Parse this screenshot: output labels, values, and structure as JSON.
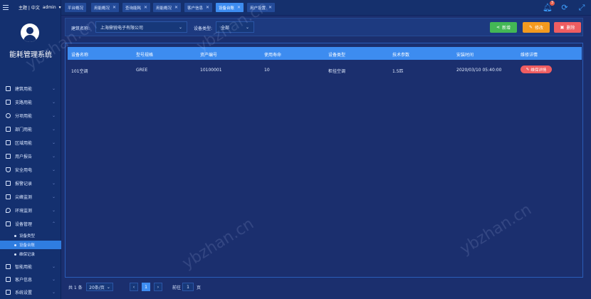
{
  "header": {
    "user_menu": "主题 | 中文",
    "username": "admin",
    "notification_count": "3"
  },
  "tabs": [
    {
      "label": "平台概况",
      "closable": false
    },
    {
      "label": "用能概况",
      "closable": true
    },
    {
      "label": "查询能耗",
      "closable": true
    },
    {
      "label": "用能概况",
      "closable": true
    },
    {
      "label": "客户信息",
      "closable": true
    },
    {
      "label": "设备台账",
      "closable": true,
      "active": true
    },
    {
      "label": "用户设置",
      "closable": true
    }
  ],
  "sidebar": {
    "title": "能耗管理系统",
    "items": [
      {
        "label": "建筑用能",
        "icon": "building-icon"
      },
      {
        "label": "支路用能",
        "icon": "branch-icon"
      },
      {
        "label": "分项用能",
        "icon": "pie-icon"
      },
      {
        "label": "部门用能",
        "icon": "department-icon"
      },
      {
        "label": "区域用能",
        "icon": "region-icon"
      },
      {
        "label": "用户报告",
        "icon": "report-icon"
      },
      {
        "label": "安全用电",
        "icon": "shield-icon"
      },
      {
        "label": "报警记录",
        "icon": "alarm-icon"
      },
      {
        "label": "尖峰监测",
        "icon": "monitor-icon"
      },
      {
        "label": "环境监测",
        "icon": "location-icon"
      },
      {
        "label": "设备管理",
        "icon": "wrench-icon"
      }
    ],
    "sub_items": [
      {
        "label": "设备类型",
        "active": false
      },
      {
        "label": "设备台账",
        "active": true
      },
      {
        "label": "维保记录",
        "active": false
      }
    ],
    "bottom_items": [
      {
        "label": "智能用能",
        "icon": "smart-icon"
      },
      {
        "label": "客户信息",
        "icon": "book-icon"
      },
      {
        "label": "系统设置",
        "icon": "settings-icon"
      }
    ]
  },
  "filters": {
    "building_label": "建筑名称:",
    "building_value": "上海鼎锐电子有限公司",
    "type_label": "设备类型:",
    "type_value": "全部"
  },
  "actions": {
    "add": "新增",
    "edit": "修改",
    "delete": "删除"
  },
  "table": {
    "columns": [
      "设备名称",
      "型号规格",
      "资产编号",
      "使用寿命",
      "设备类型",
      "技术参数",
      "安装时间",
      "维修详情"
    ],
    "rows": [
      {
        "name": "101空调",
        "model": "GREE",
        "asset": "10100001",
        "life": "10",
        "type": "柜挂空调",
        "spec": "1.5匹",
        "install": "2020/03/10 05:40:00",
        "detail": "维保详情"
      }
    ]
  },
  "pager": {
    "total": "共 1 条",
    "page_size": "20条/页",
    "prev": "‹",
    "current": "1",
    "next": "›",
    "goto_label": "前往",
    "goto_value": "1",
    "page_suffix": "页"
  },
  "watermarks": [
    "ybzhan.cn",
    "ybzhan.cn",
    "ybzhan.cn",
    "ybzhan.cn"
  ],
  "colors": {
    "primary": "#3d8cf0",
    "add": "#43b755",
    "edit": "#f39a1f",
    "delete": "#ef5d61",
    "sidebar": "#14306f",
    "bg": "#1b2f6e"
  }
}
